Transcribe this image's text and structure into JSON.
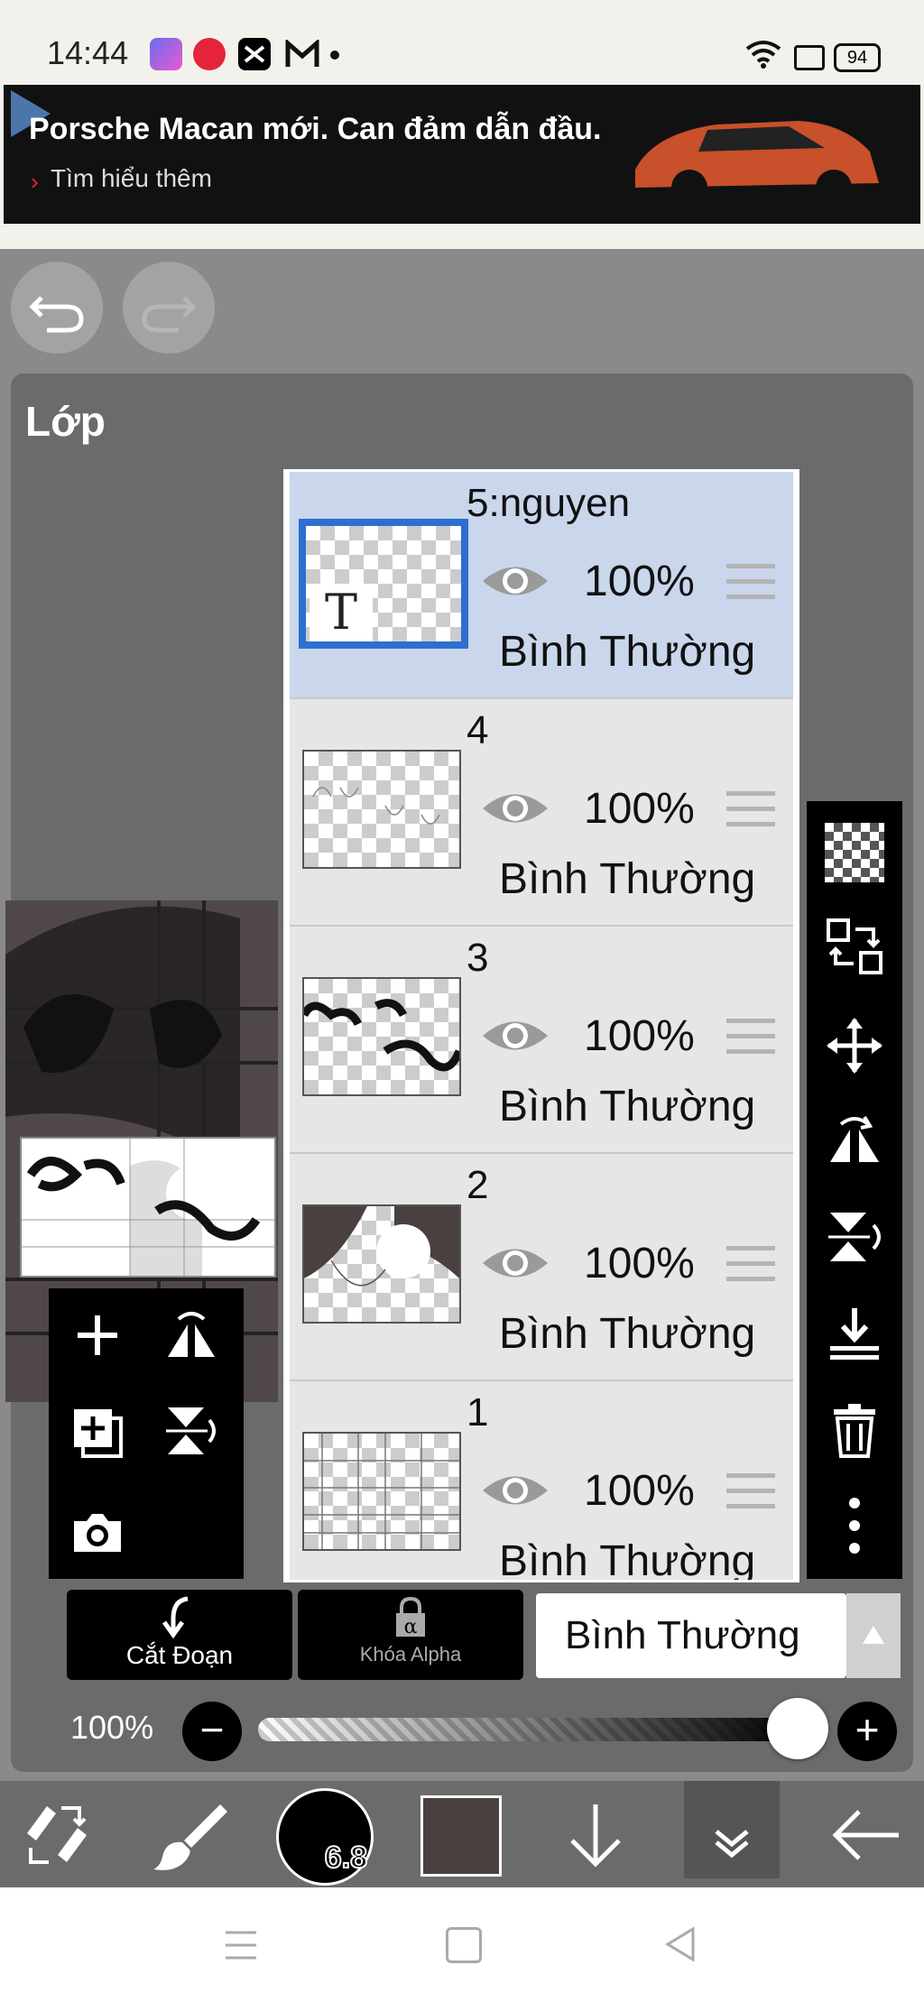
{
  "status_bar": {
    "time": "14:44",
    "battery": "94"
  },
  "ad": {
    "title": "Porsche Macan mới. Can đảm dẫn đầu.",
    "link": "Tìm hiểu thêm"
  },
  "panel": {
    "title": "Lớp"
  },
  "layers": [
    {
      "name": "5:nguyen",
      "opacity": "100%",
      "blend": "Bình Thường",
      "selected": true
    },
    {
      "name": "4",
      "opacity": "100%",
      "blend": "Bình Thường",
      "selected": false
    },
    {
      "name": "3",
      "opacity": "100%",
      "blend": "Bình Thường",
      "selected": false
    },
    {
      "name": "2",
      "opacity": "100%",
      "blend": "Bình Thường",
      "selected": false
    },
    {
      "name": "1",
      "opacity": "100%",
      "blend": "Bình Thường",
      "selected": false
    }
  ],
  "layer5_thumb_text": "T",
  "controls": {
    "clip_label": "Cắt Đoạn",
    "alpha_lock_label": "Khóa Alpha",
    "blend_mode": "Bình Thường",
    "opacity": "100%",
    "opacity_fraction": 1.0
  },
  "brush_size": "6.8",
  "colors": {
    "accent": "#2d6fd0",
    "selected_layer": "#cad6eb",
    "current_color": "#4a4040"
  }
}
